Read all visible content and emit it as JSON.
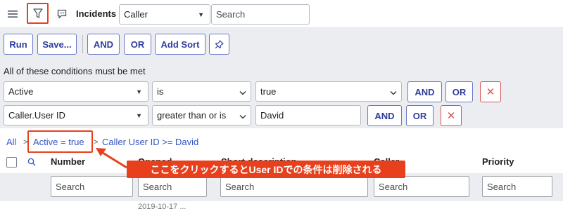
{
  "header": {
    "menu_icon": "hamburger-menu-icon",
    "filter_icon": "funnel-icon",
    "chat_icon": "chat-bubble-icon",
    "title": "Incidents",
    "search_field_select": "Caller",
    "search_input_placeholder": "Search"
  },
  "toolbar": {
    "run_label": "Run",
    "save_label": "Save...",
    "and_label": "AND",
    "or_label": "OR",
    "add_sort_label": "Add Sort",
    "pin_icon": "pushpin-icon"
  },
  "conditions": {
    "heading": "All of these conditions must be met",
    "rows": [
      {
        "field": "Active",
        "operator": "is",
        "value": "true",
        "and_label": "AND",
        "or_label": "OR",
        "remove_label": "✕"
      },
      {
        "field": "Caller.User ID",
        "operator": "greater than or is",
        "value": "David",
        "and_label": "AND",
        "or_label": "OR",
        "remove_label": "✕"
      }
    ]
  },
  "breadcrumb": {
    "all": "All",
    "sep": ">",
    "item1": "Active = true",
    "item2": "Caller User ID >= David"
  },
  "table": {
    "columns": [
      "Number",
      "Opened",
      "Short description",
      "Caller",
      "Priority"
    ],
    "search_placeholder": "Search",
    "partial_row_text": "2019-10-17 ..."
  },
  "annotation": {
    "callout_text": "ここをクリックするとUser IDでの条件は削除される",
    "color": "#e8401c"
  },
  "colors": {
    "accent_button": "#2f3d9c",
    "link": "#3555c4",
    "remove": "#d9534f",
    "panel_bg": "#ebedf0"
  }
}
